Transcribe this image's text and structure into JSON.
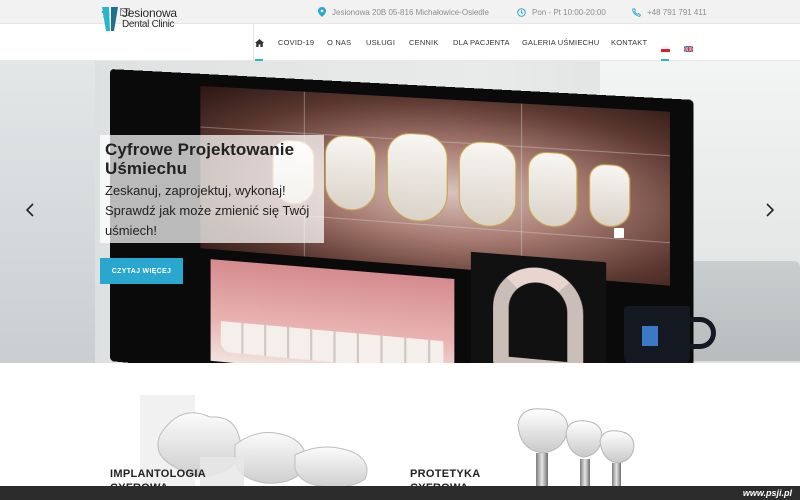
{
  "topbar": {
    "address": "Jesionowa 20B 05-816 Michałowice-Osiedle",
    "hours": "Pon - Pt 10:00-20:00",
    "phone": "+48 791 791 411",
    "icons": [
      "facebook-icon",
      "mail-icon",
      "map-pin-icon",
      "clock-icon",
      "phone-icon"
    ]
  },
  "logo": {
    "line1": "Jesionowa",
    "line2": "Dental Clinic"
  },
  "nav": {
    "items": [
      "COVID-19",
      "O NAS",
      "USŁUGI",
      "CENNIK",
      "DLA PACJENTA",
      "GALERIA UŚMIECHU",
      "KONTAKT"
    ],
    "active_index": 7,
    "languages": [
      "pl",
      "en"
    ]
  },
  "hero": {
    "title": "Cyfrowe Projektowanie Uśmiechu",
    "subtitle": "Zeskanuj, zaprojektuj, wykonaj! Sprawdź jak może zmienić się Twój uśmiech!",
    "cta": "CZYTAJ WIĘCEJ"
  },
  "services": [
    {
      "title_line1": "IMPLANTOLOGIA",
      "title_line2": "CYFROWA"
    },
    {
      "title_line1": "PROTETYKA",
      "title_line2": "CYFROWA"
    }
  ],
  "watermark": "www.psji.pl",
  "colors": {
    "accent": "#29a7cf",
    "underline": "#2bb5c8",
    "text": "#222222"
  }
}
